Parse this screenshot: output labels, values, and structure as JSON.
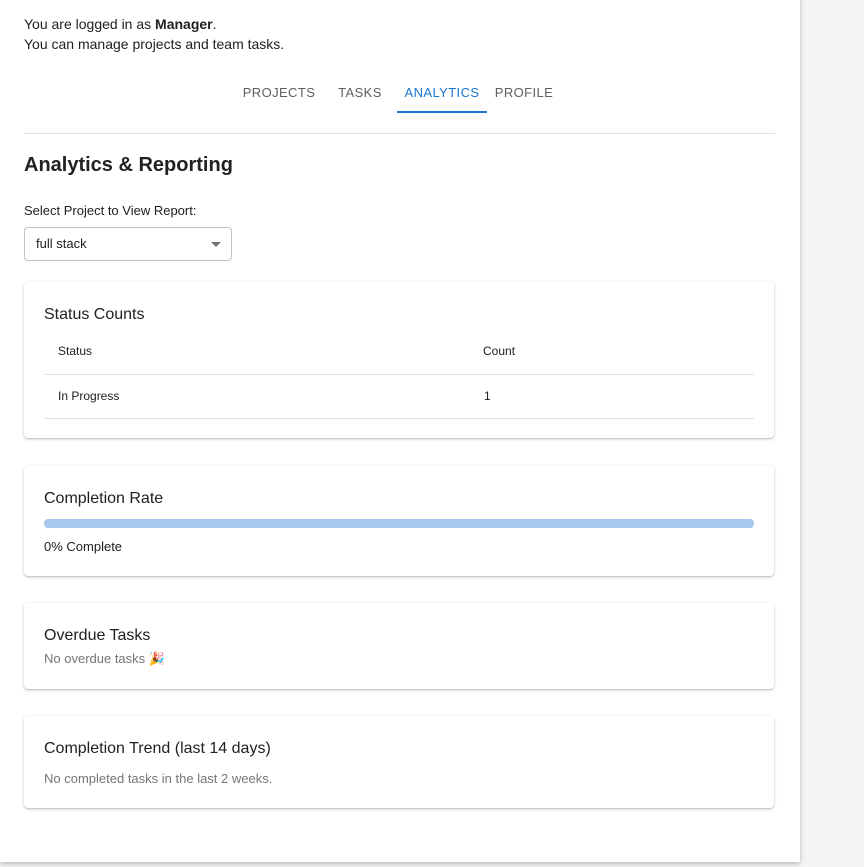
{
  "header": {
    "logged_prefix": "You are logged in as ",
    "role": "Manager",
    "logged_suffix": ".",
    "manage_text": "You can manage projects and team tasks."
  },
  "tabs": [
    {
      "label": "PROJECTS",
      "active": false
    },
    {
      "label": "TASKS",
      "active": false
    },
    {
      "label": "ANALYTICS",
      "active": true
    },
    {
      "label": "PROFILE",
      "active": false
    }
  ],
  "analytics": {
    "title": "Analytics & Reporting",
    "select_label": "Select Project to View Report:",
    "selected_project": "full stack"
  },
  "status_counts": {
    "title": "Status Counts",
    "headers": {
      "status": "Status",
      "count": "Count"
    },
    "rows": [
      {
        "status": "In Progress",
        "count": "1"
      }
    ]
  },
  "completion_rate": {
    "title": "Completion Rate",
    "value_percent": 0,
    "label": "0% Complete"
  },
  "overdue": {
    "title": "Overdue Tasks",
    "message": "No overdue tasks 🎉"
  },
  "trend": {
    "title": "Completion Trend (last 14 days)",
    "message": "No completed tasks in the last 2 weeks."
  },
  "colors": {
    "accent": "#1976d2",
    "progress_track": "#a8c8ef"
  }
}
